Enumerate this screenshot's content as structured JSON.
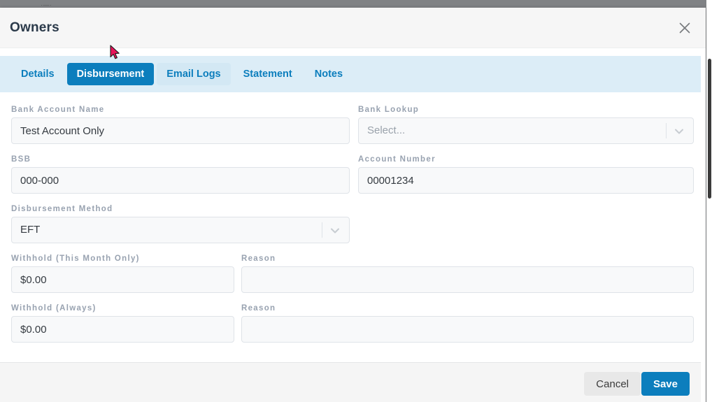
{
  "backdrop": {
    "ghost_text": "·—·"
  },
  "dialog": {
    "title": "Owners",
    "close_icon": "close-icon"
  },
  "tabs": [
    {
      "label": "Details",
      "state": "normal"
    },
    {
      "label": "Disbursement",
      "state": "active"
    },
    {
      "label": "Email Logs",
      "state": "hovered"
    },
    {
      "label": "Statement",
      "state": "normal"
    },
    {
      "label": "Notes",
      "state": "normal"
    }
  ],
  "form": {
    "bank_account_name": {
      "label": "Bank Account Name",
      "value": "Test Account Only",
      "placeholder": ""
    },
    "bank_lookup": {
      "label": "Bank Lookup",
      "value": "Select...",
      "is_placeholder": true,
      "icon": "chevron-down-icon"
    },
    "bsb": {
      "label": "BSB",
      "value": "000-000",
      "placeholder": ""
    },
    "account_number": {
      "label": "Account Number",
      "value": "00001234",
      "placeholder": ""
    },
    "disbursement_method": {
      "label": "Disbursement Method",
      "value": "EFT",
      "is_placeholder": false,
      "icon": "chevron-down-icon"
    },
    "withhold_this_month": {
      "label": "Withhold (This Month Only)",
      "value": "$0.00",
      "placeholder": ""
    },
    "reason_this_month": {
      "label": "Reason",
      "value": "",
      "placeholder": ""
    },
    "withhold_always": {
      "label": "Withhold (Always)",
      "value": "$0.00",
      "placeholder": ""
    },
    "reason_always": {
      "label": "Reason",
      "value": "",
      "placeholder": ""
    }
  },
  "footer": {
    "cancel_label": "Cancel",
    "save_label": "Save"
  },
  "colors": {
    "accent": "#0c7ebd",
    "tab_bar_bg": "#dcedf7",
    "header_bg": "#f6f6f6",
    "footer_bg": "#f5f5f5",
    "label_gray": "#98a2b0",
    "input_bg": "#f8f9fa",
    "input_border": "#dfe3e8",
    "backdrop": "#808285",
    "cursor": "#e8145a"
  }
}
